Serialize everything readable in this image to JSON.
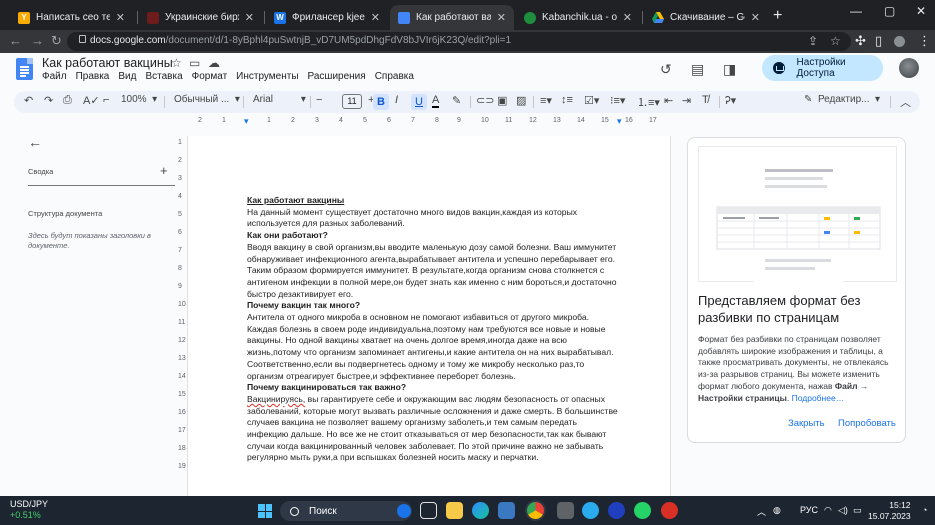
{
  "browser": {
    "tabs": [
      {
        "title": "Написать сео текст на рус",
        "favicon_color": "#f9ab00",
        "favicon_glyph": "Y"
      },
      {
        "title": "Украинские биржи копир",
        "favicon_color": "#6d1b1b",
        "favicon_glyph": ""
      },
      {
        "title": "Фрилансер kjeero | бирж",
        "favicon_color": "#1a73e8",
        "favicon_glyph": "W"
      },
      {
        "title": "Как работают вакцины -",
        "favicon_color": "#4285f4",
        "favicon_glyph": ""
      },
      {
        "title": "Kabanchik.ua - онлайн-се",
        "favicon_color": "#1e8e3e",
        "favicon_glyph": ""
      },
      {
        "title": "Скачивание – Google Дис",
        "favicon_color": "#fbbc04",
        "favicon_glyph": ""
      }
    ],
    "active_tab": 3,
    "url_host": "docs.google.com",
    "url_path": "/document/d/1-8yBphl4puSwtnjB_vD7UM5pdDhgFdV8bJVIr6jK23Q/edit?pli=1"
  },
  "docs": {
    "title": "Как работают вакцины",
    "menu": [
      "Файл",
      "Правка",
      "Вид",
      "Вставка",
      "Формат",
      "Инструменты",
      "Расширения",
      "Справка"
    ],
    "share_label": "Настройки Доступа",
    "toolbar": {
      "zoom": "100%",
      "style": "Обычный ...",
      "font": "Arial",
      "font_size": "11",
      "mode": "Редактир..."
    },
    "ruler": [
      "2",
      "1",
      "1",
      "2",
      "3",
      "4",
      "5",
      "6",
      "7",
      "8",
      "9",
      "10",
      "11",
      "12",
      "13",
      "14",
      "15",
      "16",
      "17"
    ],
    "vruler": [
      "1",
      "2",
      "3",
      "4",
      "5",
      "6",
      "7",
      "8",
      "9",
      "10",
      "11",
      "12",
      "13",
      "14",
      "15",
      "16",
      "17",
      "18",
      "19"
    ]
  },
  "outline": {
    "summary_label": "Сводка",
    "structure_label": "Структура документа",
    "hint": "Здесь будут показаны заголовки в документе."
  },
  "document": {
    "h_title": "Как работают вакцины",
    "p1": "На данный момент существует достаточно много видов вакцин,каждая из которых используется для разных заболеваний.",
    "h2": "Как они работают?",
    "p2": "Вводя вакцину в свой организм,вы вводите маленькую дозу самой болезни. Ваш иммунитет обнаруживает инфекционного агента,вырабатывает антитела и успешно перебарывает его. Таким образом формируется иммунитет. В результате,когда организм снова столкнется с антигеном инфекции в полной мере,он будет знать как именно с ним бороться,и достаточно быстро дезактивирует его.",
    "h3": "Почему вакцин так много?",
    "p3": "Антитела от одного микроба в основном не помогают избавиться от другого микроба. Каждая болезнь в своем роде индивидуальна,поэтому нам требуются все новые и новые вакцины. Но одной вакцины хватает на очень долгое время,иногда даже на всю жизнь,потому что организм запоминает антигены,и какие антитела он на них вырабатывал. Соответственно,если вы подвергнетесь одному и тому же микробу несколько раз,то организм отреагирует быстрее,и эффективнее переборет болезнь.",
    "h4": "Почему вакцинироваться так важно?",
    "p4_word": "Вакцинируясь,",
    "p4": " вы гарантируете себе и окружающим вас людям безопасность от опасных заболеваний, которые могут вызвать различные осложнения и даже смерть. В большинстве случаев вакцина не позволяет вашему организму заболеть,и тем самым передать инфекцию дальше. Но все же не стоит отказываться от мер безопасности,так как бывают случаи когда вакцинированный человек заболевает. По этой причине важно не забывать регулярно мыть руки,а при вспышках болезней носить маску и перчатки."
  },
  "promo": {
    "title": "Представляем формат без разбивки по страницам",
    "body": "Формат без разбивки по страницам позволяет добавлять широкие изображения и таблицы, а также просматривать документы, не отвлекаясь из-за разрывов страниц. Вы можете изменить формат любого документа, нажав ",
    "bold": "Файл → Настройки страницы",
    "dot": ". ",
    "link": "Подробнее…",
    "close_label": "Закрыть",
    "try_label": "Попробовать"
  },
  "taskbar": {
    "ticker": "USD/JPY",
    "change": "+0.51%",
    "search": "Поиск",
    "lang": "РУС",
    "time": "15:12",
    "date": "15.07.2023"
  }
}
